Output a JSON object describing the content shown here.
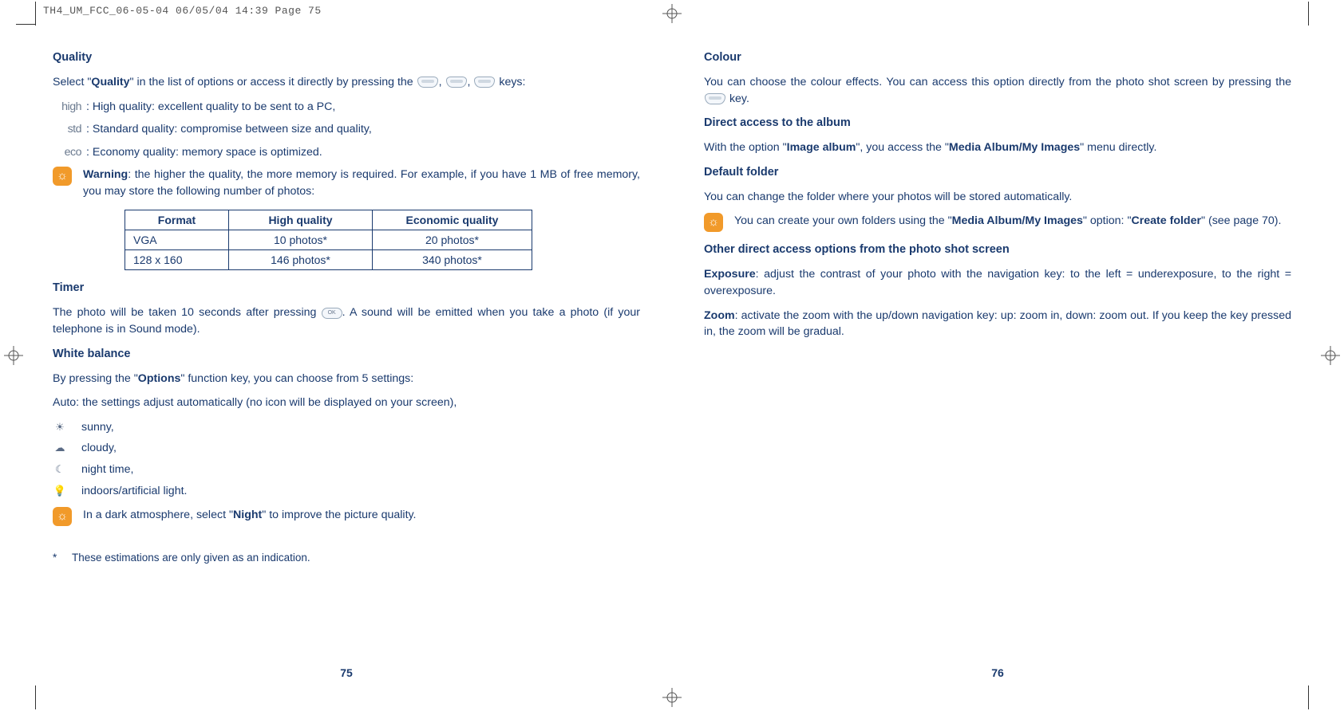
{
  "print_header": "TH4_UM_FCC_06-05-04  06/05/04  14:39  Page 75",
  "left": {
    "quality": {
      "heading": "Quality",
      "intro_a": "Select \"",
      "intro_b": "Quality",
      "intro_c": "\" in the list of options or access it directly by pressing the ",
      "intro_d": " keys:",
      "high_label": "high",
      "high_text": ": High quality: excellent quality to be sent to a PC,",
      "std_label": "std",
      "std_text": ": Standard quality: compromise between size and quality,",
      "eco_label": "eco",
      "eco_text": ": Economy quality: memory space is optimized.",
      "warn_b": "Warning",
      "warn_rest": ": the higher the quality, the more memory is required. For example, if you have 1 MB of free memory, you may store the following number of photos:",
      "table": {
        "h1": "Format",
        "h2": "High quality",
        "h3": "Economic quality",
        "r1c1": "VGA",
        "r1c2": "10 photos*",
        "r1c3": "20 photos*",
        "r2c1": "128 x 160",
        "r2c2": "146 photos*",
        "r2c3": "340 photos*"
      }
    },
    "timer": {
      "heading": "Timer",
      "text_a": "The photo will be taken 10 seconds after pressing ",
      "text_b": ". A sound will be emitted when you take a photo (if your telephone is in Sound mode)."
    },
    "wb": {
      "heading": "White balance",
      "intro_a": "By pressing the \"",
      "intro_b": "Options",
      "intro_c": "\" function key, you can choose from 5 settings:",
      "auto": "Auto: the settings adjust automatically (no icon will be displayed on your screen),",
      "sunny": "sunny,",
      "cloudy": "cloudy,",
      "night": "night time,",
      "indoor": "indoors/artificial light.",
      "tip_a": "In a dark atmosphere, select \"",
      "tip_b": "Night",
      "tip_c": "\" to improve the picture quality."
    },
    "footnote": "These estimations are only given as an indication.",
    "pagenum": "75"
  },
  "right": {
    "colour": {
      "heading": "Colour",
      "text_a": "You can choose the colour effects. You can access this option directly from the photo shot screen by pressing the ",
      "text_b": " key."
    },
    "album": {
      "heading": "Direct access to the album",
      "text_a": "With the option \"",
      "text_b": "Image album",
      "text_c": "\", you access the \"",
      "text_d": "Media Album/My Images",
      "text_e": "\" menu directly."
    },
    "default_folder": {
      "heading": "Default folder",
      "text": "You can change the folder where your photos will be stored automatically.",
      "tip_a": "You can create your own folders using the \"",
      "tip_b": "Media Album/My Images",
      "tip_c": "\" option: \"",
      "tip_d": "Create folder",
      "tip_e": "\" (see page 70)."
    },
    "other": {
      "heading": "Other direct access options from the photo shot screen",
      "exp_b": "Exposure",
      "exp_rest": ": adjust the contrast of your photo with the navigation key: to the left = underexposure, to the right = overexposure.",
      "zoom_b": "Zoom",
      "zoom_rest": ": activate the zoom with the up/down navigation key: up: zoom in, down: zoom out. If you keep the key pressed in, the zoom will be gradual."
    },
    "pagenum": "76"
  }
}
